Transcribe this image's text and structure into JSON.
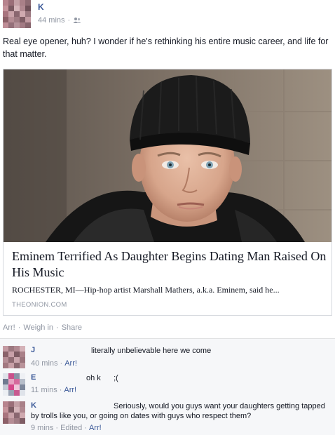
{
  "post": {
    "author": "K",
    "time": "44 mins",
    "separator": "·",
    "privacy_icon": "friends-icon",
    "text": "Real eye opener, huh? I wonder if he's rethinking his entire music career, and life for that matter."
  },
  "share": {
    "image_desc": "photo",
    "title": "Eminem Terrified As Daughter Begins Dating Man Raised On His Music",
    "description": "ROCHESTER, MI—Hip-hop artist Marshall Mathers, a.k.a. Eminem, said he...",
    "source": "THEONION.COM"
  },
  "actions": {
    "like": "Arr!",
    "comment": "Weigh in",
    "share": "Share",
    "sep": "·"
  },
  "comments": [
    {
      "author": "J",
      "text": "literally unbelievable here we come",
      "time": "40 mins",
      "like": "Arr!",
      "sep": "·"
    },
    {
      "author": "E",
      "text": "oh k      ;(",
      "time": "11 mins",
      "like": "Arr!",
      "sep": "·"
    },
    {
      "author": "K",
      "text": "Seriously, would you guys want your daughters getting tapped by trolls like you, or going on dates with guys who respect them?",
      "time": "9 mins",
      "edited": "Edited",
      "like": "Arr!",
      "sep": "·"
    }
  ],
  "colors": {
    "link": "#3b5998",
    "meta": "#9197a3",
    "text": "#141823",
    "comment_bg": "#f6f7f9"
  }
}
